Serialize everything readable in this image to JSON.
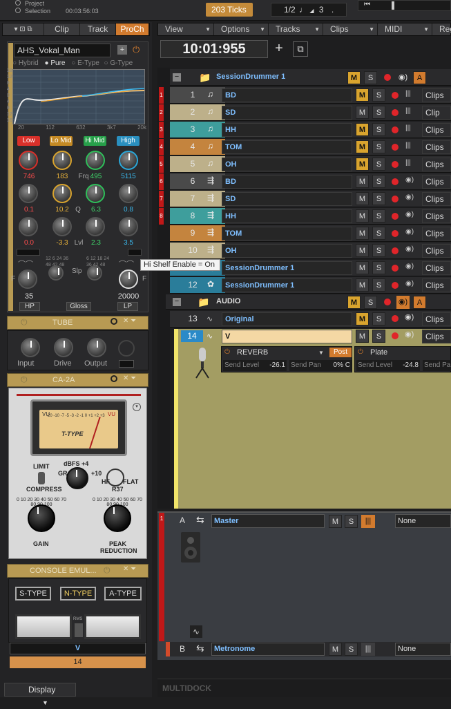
{
  "topbar": {
    "project_label": "Project",
    "selection_label": "Selection",
    "selection_time": "00:03:56:03",
    "ticks": "203 Ticks",
    "fraction": "1/2",
    "fraction_value": "3"
  },
  "inspector": {
    "tabs": [
      "Clip",
      "Track",
      "ProCh"
    ],
    "active_tab": "ProCh",
    "eq": {
      "preset": "AHS_Vokal_Man",
      "modes": [
        "Hybrid",
        "Pure",
        "E-Type",
        "G-Type"
      ],
      "selected_mode": "Pure",
      "db_scale": [
        "18",
        "12",
        "8",
        "4",
        "0",
        "4",
        "8",
        "12",
        "16"
      ],
      "freq_scale": [
        "20",
        "112",
        "632",
        "3k7",
        "20k"
      ],
      "bands": [
        {
          "label": "Low",
          "color": "#d9302a",
          "freq": "746",
          "q": "0.1",
          "level": "0.0",
          "val_color": "#ff4d4d"
        },
        {
          "label": "Lo Mid",
          "color": "#d9a42e",
          "freq": "183",
          "q": "10.2",
          "level": "-3.3",
          "val_color": "#e8b23a"
        },
        {
          "label": "Hi Mid",
          "color": "#2fbf5a",
          "freq": "495",
          "q": "6.3",
          "level": "2.3",
          "val_color": "#3fd66a"
        },
        {
          "label": "High",
          "color": "#2aa7d9",
          "freq": "5115",
          "q": "0.8",
          "level": "3.5",
          "val_color": "#3ab7ec"
        }
      ],
      "frq_label": "Frq",
      "q_label": "Q",
      "lvl_label": "Lvl",
      "slp_label": "Slp",
      "slope_left_scale": "12 6 24 36 48 42 48",
      "slope_right_scale": "6 12 18 24 36 42 48",
      "hp_freq": "35",
      "lp_freq": "20000",
      "hp_label": "HP",
      "gloss_label": "Gloss",
      "lp_label": "LP",
      "f_left": "F",
      "f_right": "F"
    },
    "tube": {
      "title": "TUBE",
      "knobs": [
        "Input",
        "Drive",
        "Output"
      ]
    },
    "ca2a": {
      "title": "CA-2A",
      "meter_brand": "T-TYPE",
      "meter_label_left": "VU",
      "meter_label_right": "VU",
      "meter_scale": "-20 -10 -7 -5 -3 -2 -1 0 +1 +2 +3",
      "dbfs": "dBFS",
      "gr": "GR",
      "plus4": "+4",
      "plus10": "+10",
      "limit": "LIMIT",
      "compress": "COMPRESS",
      "hf": "HF",
      "flat": "FLAT",
      "r37": "R37",
      "gain": "GAIN",
      "peak_reduction_1": "PEAK",
      "peak_reduction_2": "REDUCTION",
      "dial_scale": "0 10 20 30 40 50 60 70 80 90 100"
    },
    "console": {
      "title": "CONSOLE EMUL...",
      "types": [
        "S-TYPE",
        "N-TYPE",
        "A-TYPE"
      ],
      "selected_type": "N-TYPE",
      "rms": "RMS"
    },
    "footer": {
      "track_name": "V",
      "track_number": "14"
    },
    "display_label": "Display"
  },
  "menu": [
    "View",
    "Options",
    "Tracks",
    "Clips",
    "MIDI",
    "Regi"
  ],
  "time_display": "10:01:955",
  "tooltip": "Hi Shelf Enable = On",
  "folders": [
    {
      "name": "SessionDrummer 1",
      "m": "M",
      "s": "S",
      "a": "A"
    },
    {
      "name": "AUDIO",
      "m": "M",
      "s": "S",
      "a": "A"
    }
  ],
  "tracks": [
    {
      "num": "1",
      "name": "BD",
      "color": "#4a4a4a",
      "tab": "1",
      "clip": "Clips",
      "m_on": true,
      "icon": "midi"
    },
    {
      "num": "2",
      "name": "SD",
      "color": "#bdb08a",
      "tab": "2",
      "clip": "Clip Ga",
      "m_on": false,
      "icon": "midi"
    },
    {
      "num": "3",
      "name": "HH",
      "color": "#3e9e9c",
      "tab": "3",
      "clip": "Clips",
      "m_on": true,
      "icon": "midi"
    },
    {
      "num": "4",
      "name": "TOM",
      "color": "#c4843e",
      "tab": "4",
      "clip": "Clips",
      "m_on": true,
      "icon": "midi"
    },
    {
      "num": "5",
      "name": "OH",
      "color": "#bdb08a",
      "tab": "5",
      "clip": "Clips",
      "m_on": true,
      "icon": "midi"
    },
    {
      "num": "6",
      "name": "BD",
      "color": "#4a4a4a",
      "tab": "6",
      "clip": "Clips",
      "m_on": false,
      "icon": "audio"
    },
    {
      "num": "7",
      "name": "SD",
      "color": "#bdb08a",
      "tab": "7",
      "clip": "Clips",
      "m_on": false,
      "icon": "audio"
    },
    {
      "num": "8",
      "name": "HH",
      "color": "#3e9e9c",
      "tab": "8",
      "clip": "Clips",
      "m_on": false,
      "icon": "audio"
    },
    {
      "num": "9",
      "name": "TOM",
      "color": "#c4843e",
      "tab": "",
      "clip": "Clips",
      "m_on": false,
      "icon": "audio"
    },
    {
      "num": "10",
      "name": "OH",
      "color": "#bdb08a",
      "tab": "",
      "clip": "Clips",
      "m_on": false,
      "icon": "audio"
    },
    {
      "num": "11",
      "name": "SessionDrummer 1",
      "color": "#2a7d9a",
      "tab": "",
      "clip": "Clips",
      "m_on": false,
      "icon": "audio"
    },
    {
      "num": "12",
      "name": "SessionDrummer 1",
      "color": "#2a7d9a",
      "tab": "",
      "clip": "Clips",
      "m_on": false,
      "icon": "synth"
    }
  ],
  "audio_tracks": [
    {
      "num": "13",
      "name": "Original",
      "clip": "Clips",
      "m_on": true
    },
    {
      "num": "14",
      "name": "V",
      "clip": "Clips",
      "m_on": false
    }
  ],
  "sends": [
    {
      "name": "REVERB",
      "mode": "Post",
      "level_label": "Send Level",
      "level": "-26.1",
      "pan_label": "Send Pan",
      "pan": "0% C"
    },
    {
      "name": "Plate",
      "level_label": "Send Level",
      "level": "-24.8",
      "pan_label": "Send Pan"
    }
  ],
  "buses": [
    {
      "letter": "A",
      "name": "Master",
      "output": "None",
      "tab": "1"
    },
    {
      "letter": "B",
      "name": "Metronome",
      "output": "None"
    }
  ],
  "multidock": "MULTIDOCK"
}
